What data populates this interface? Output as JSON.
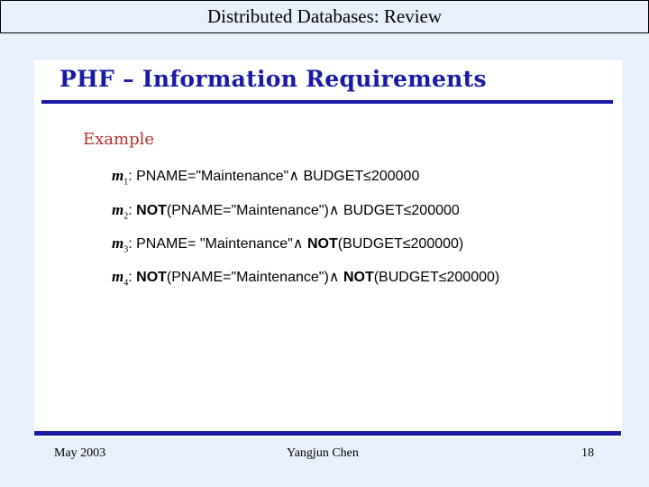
{
  "header": {
    "title": "Distributed Databases: Review"
  },
  "slide": {
    "title": "PHF – Information Requirements",
    "example_label": "Example",
    "minterms": [
      {
        "id": "m",
        "sub": "1",
        "colon": ":",
        "p1": " PNAME=\"Maintenance\"∧ BUDGET≤200000"
      },
      {
        "id": "m",
        "sub": "2",
        "colon": ":",
        "not1": " NOT",
        "p1": "(PNAME=\"Maintenance\")∧ BUDGET≤200000"
      },
      {
        "id": "m",
        "sub": "3",
        "colon": ":",
        "p1": " PNAME= \"Maintenance\"∧ ",
        "not2": "NOT",
        "p2": "(BUDGET≤200000)"
      },
      {
        "id": "m",
        "sub": "4",
        "colon": ":",
        "not1": " NOT",
        "p1": "(PNAME=\"Maintenance\")∧ ",
        "not2": "NOT",
        "p2": "(BUDGET≤200000)"
      }
    ]
  },
  "footer": {
    "date": "May 2003",
    "author": "Yangjun Chen",
    "page": "18"
  }
}
